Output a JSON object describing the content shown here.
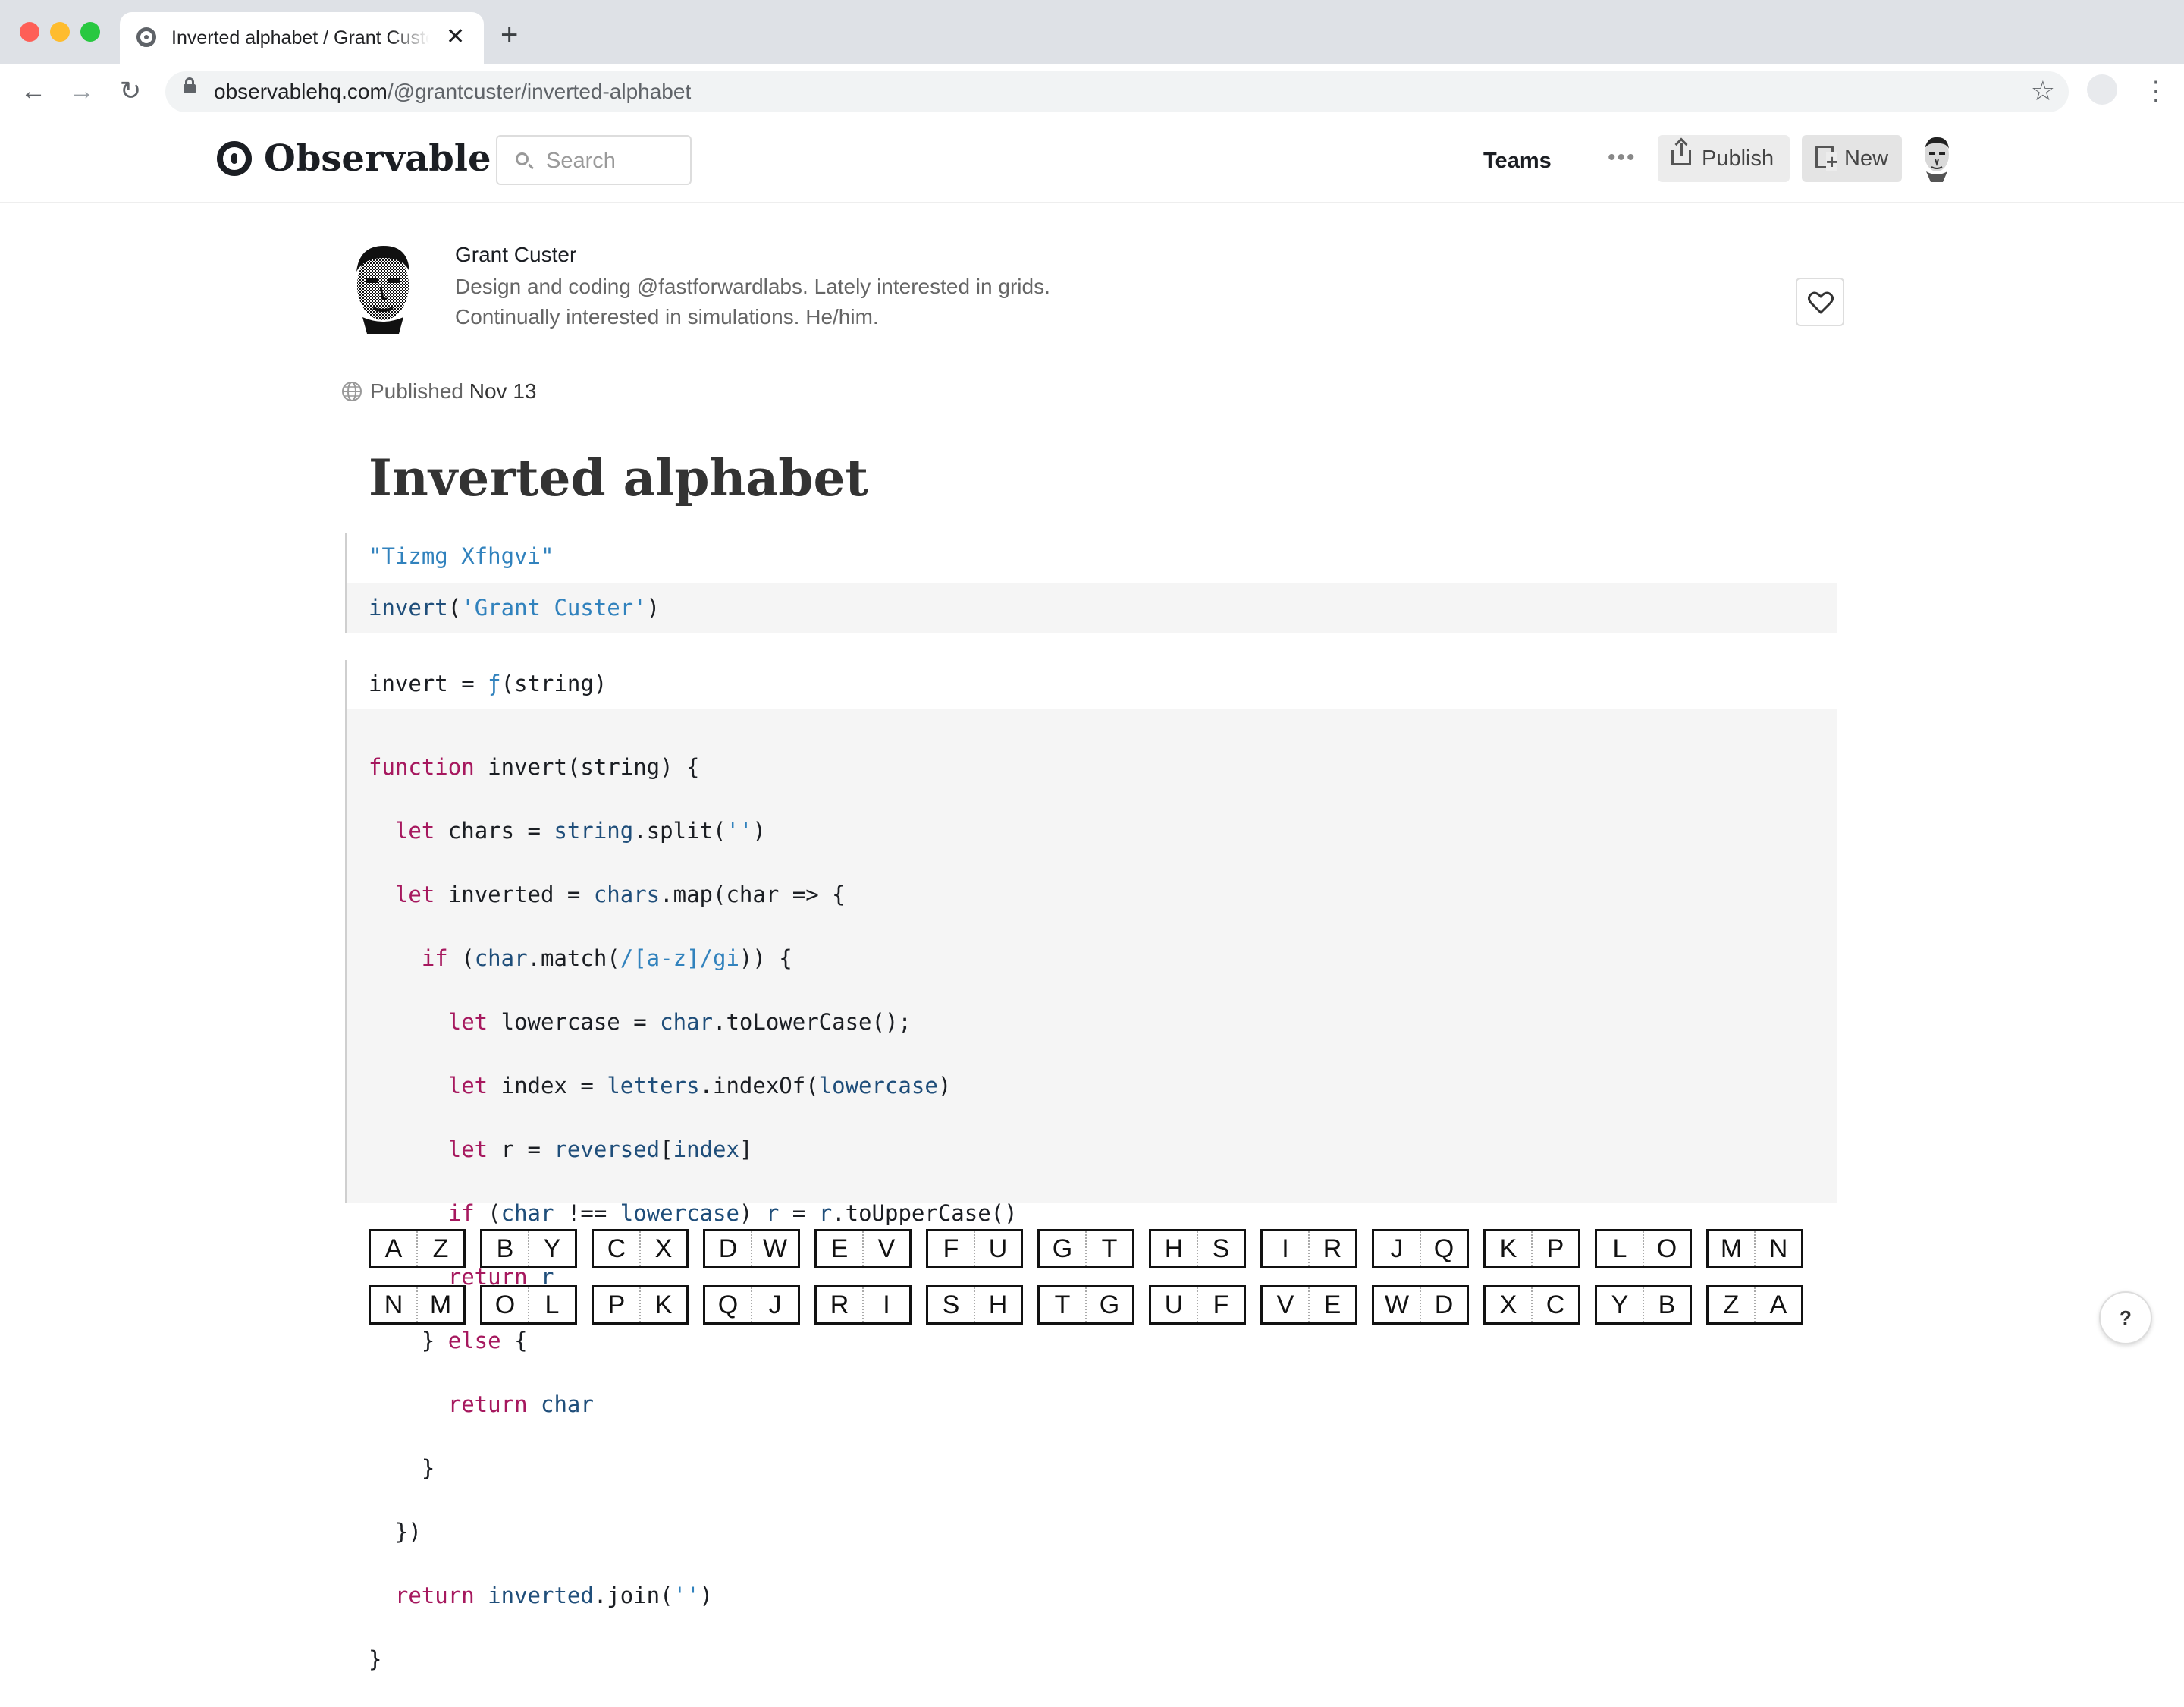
{
  "browser": {
    "tab_title": "Inverted alphabet / Grant Custer | Observable",
    "url_host": "observablehq.com",
    "url_path": "/@grantcuster/inverted-alphabet"
  },
  "header": {
    "logo_text": "Observable",
    "search_placeholder": "Search",
    "teams_label": "Teams",
    "more_label": "•••",
    "publish_label": "Publish",
    "new_label": "New"
  },
  "author": {
    "name": "Grant Custer",
    "bio_line1": "Design and coding @fastforwardlabs. Lately interested in grids.",
    "bio_line2": "Continually interested in simulations. He/him."
  },
  "published": {
    "label": "Published",
    "date": "Nov 13"
  },
  "notebook": {
    "title": "Inverted alphabet",
    "cell1_output": "\"Tizmg Xfhgvi\"",
    "cell2_output_name": "invert = ",
    "cell2_output_fn": "ƒ",
    "cell2_output_sig": "(string)"
  },
  "letter_pairs": {
    "row1": [
      "A",
      "Z",
      "B",
      "Y",
      "C",
      "X",
      "D",
      "W",
      "E",
      "V",
      "F",
      "U",
      "G",
      "T",
      "H",
      "S",
      "I",
      "R",
      "J",
      "Q",
      "K",
      "P",
      "L",
      "O",
      "M",
      "N"
    ],
    "row2": [
      "N",
      "M",
      "O",
      "L",
      "P",
      "K",
      "Q",
      "J",
      "R",
      "I",
      "S",
      "H",
      "T",
      "G",
      "U",
      "F",
      "V",
      "E",
      "W",
      "D",
      "X",
      "C",
      "Y",
      "B",
      "Z",
      "A"
    ]
  },
  "help_label": "?",
  "colors": {
    "keyword": "#a6185e",
    "definition": "#1f4e7a",
    "string": "#3182bd",
    "code_background": "#f5f5f5"
  },
  "icons": [
    "observable-logo-icon",
    "search-icon",
    "publish-icon",
    "new-notebook-icon",
    "heart-icon",
    "globe-icon",
    "lock-icon",
    "star-icon"
  ]
}
